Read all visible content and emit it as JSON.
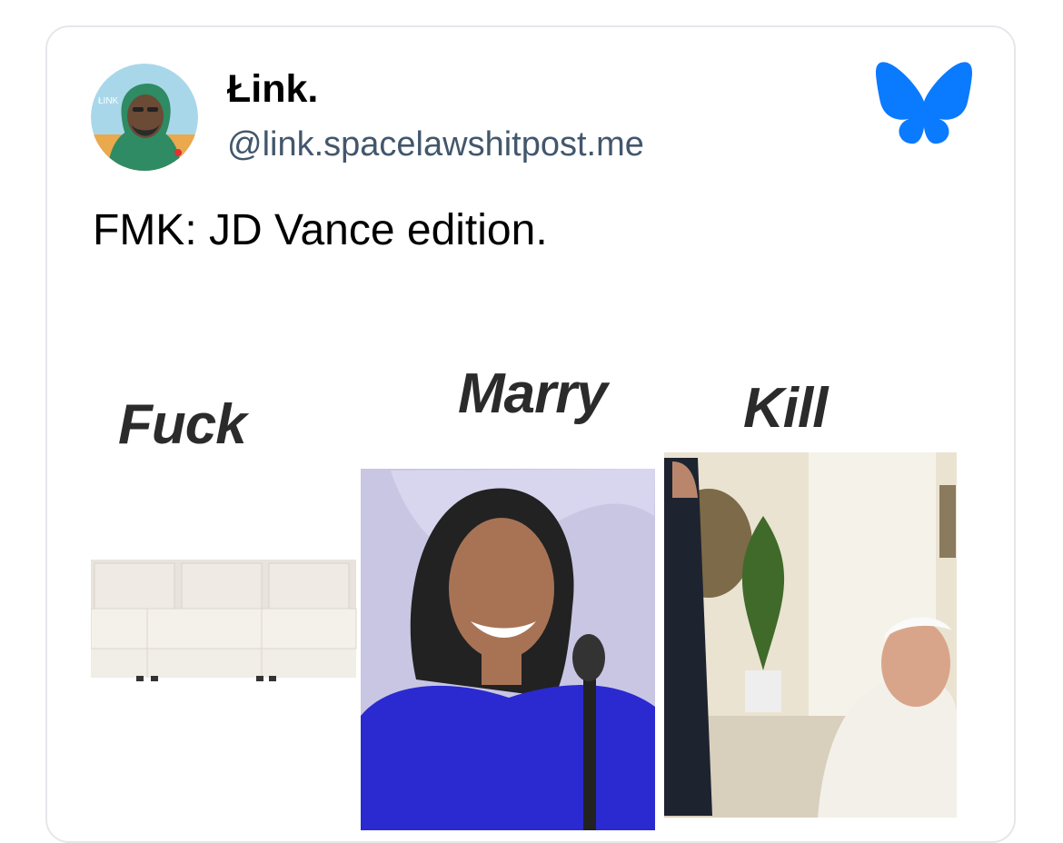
{
  "post": {
    "author": {
      "display_name": "Łink.",
      "handle": "@link.spacelawshitpost.me",
      "avatar_icon": "avatar-illustration"
    },
    "platform_icon": "bluesky-butterfly-icon",
    "text": "FMK: JD Vance edition.",
    "image": {
      "labels": [
        "Fuck",
        "Marry",
        "Kill"
      ],
      "panels": [
        "couch",
        "woman-in-blue-dress-at-microphone",
        "man-meeting-seated-cleric"
      ]
    }
  },
  "colors": {
    "brand_blue": "#0a7aff",
    "handle_gray": "#42576c",
    "card_border": "#e5e7eb"
  }
}
